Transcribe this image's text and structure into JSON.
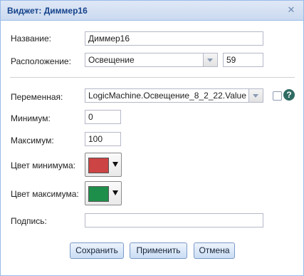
{
  "window": {
    "title": "Виджет: Диммер16"
  },
  "form": {
    "name_label": "Название:",
    "name_value": "Диммер16",
    "location_label": "Расположение:",
    "location_value": "Освещение",
    "location_number": "59",
    "variable_label": "Переменная:",
    "variable_value": "LogicMachine.Освещение_8_2_22.Value",
    "min_label": "Минимум:",
    "min_value": "0",
    "max_label": "Максимум:",
    "max_value": "100",
    "min_color_label": "Цвет минимума:",
    "min_color": "#cc4444",
    "max_color_label": "Цвет максимума:",
    "max_color": "#1e8f4a",
    "caption_label": "Подпись:",
    "caption_value": ""
  },
  "buttons": {
    "save": "Сохранить",
    "apply": "Применить",
    "cancel": "Отмена"
  },
  "icons": {
    "close": "close-icon",
    "help": "?"
  }
}
